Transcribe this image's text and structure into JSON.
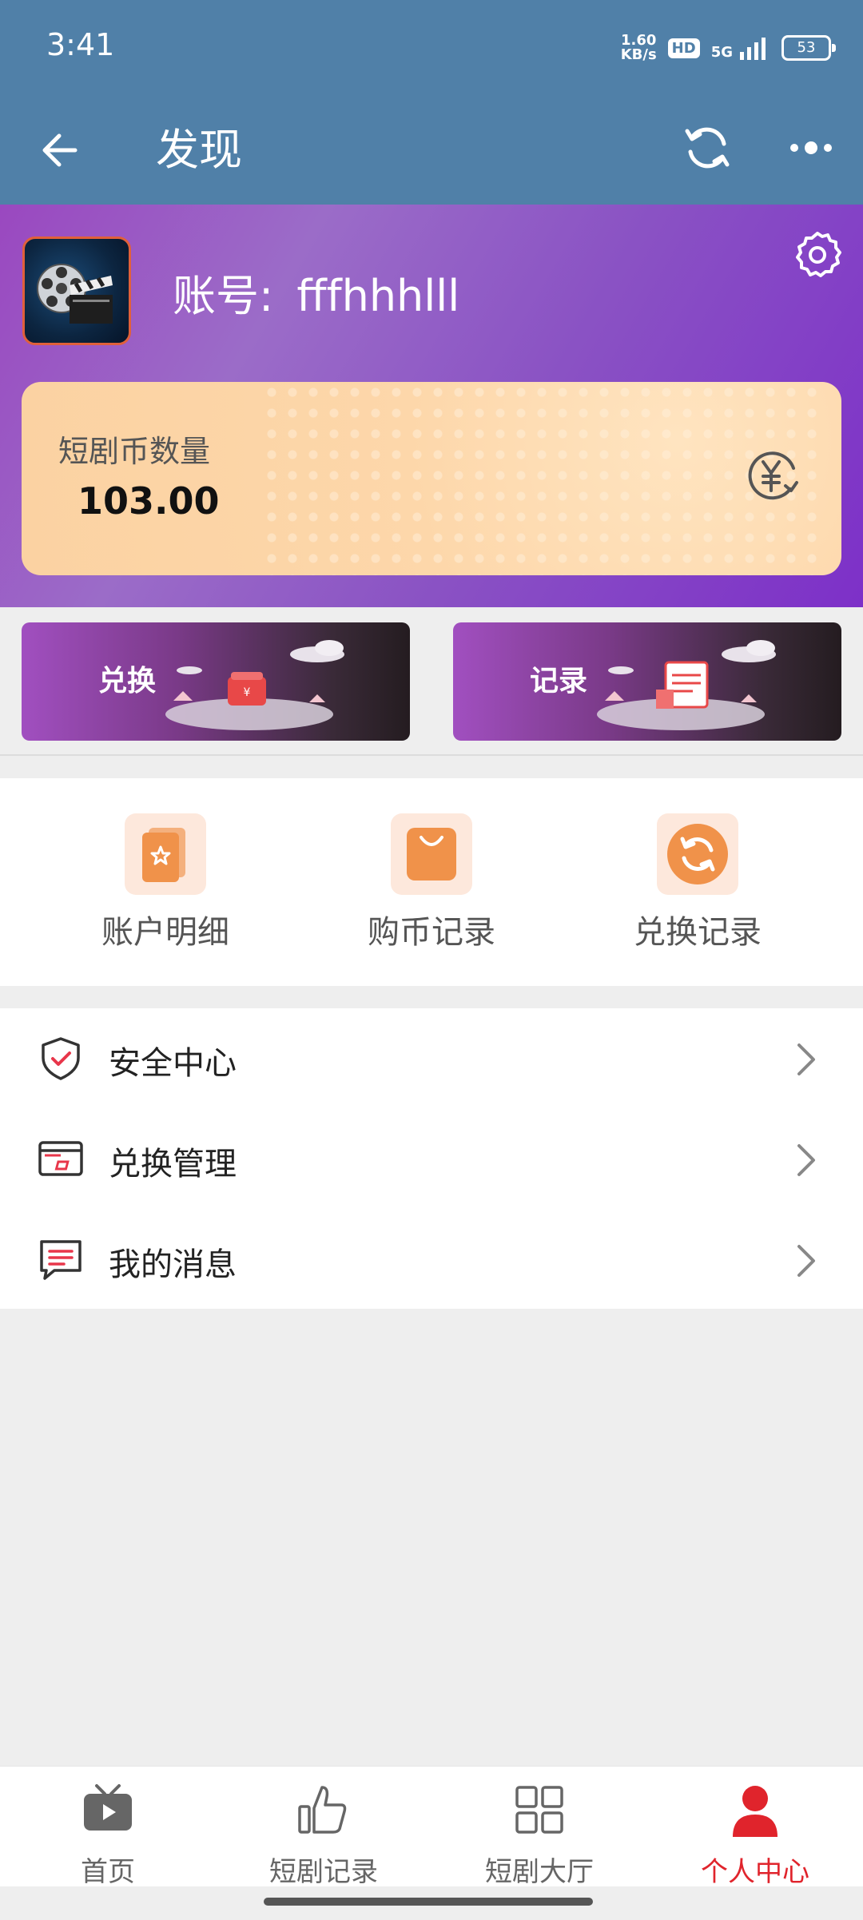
{
  "status_bar": {
    "time": "3:41",
    "net_speed_value": "1.60",
    "net_speed_unit": "KB/s",
    "hd_badge": "HD",
    "network": "5G",
    "battery": "53"
  },
  "app_bar": {
    "title": "发现"
  },
  "profile": {
    "account_label": "账号:",
    "account_value": "fffhhhlll",
    "coin_label": "短剧币数量",
    "coin_value": "103.00"
  },
  "banners": {
    "exchange_label": "兑换",
    "record_label": "记录"
  },
  "shortcuts": [
    {
      "label": "账户明细",
      "icon": "document-star-icon"
    },
    {
      "label": "购币记录",
      "icon": "shopping-bag-icon"
    },
    {
      "label": "兑换记录",
      "icon": "exchange-cycle-icon"
    }
  ],
  "menu": [
    {
      "label": "安全中心",
      "icon": "shield-check-icon"
    },
    {
      "label": "兑换管理",
      "icon": "card-icon"
    },
    {
      "label": "我的消息",
      "icon": "message-icon"
    }
  ],
  "tabbar": [
    {
      "label": "首页",
      "icon": "tv-play-icon"
    },
    {
      "label": "短剧记录",
      "icon": "thumbs-up-icon"
    },
    {
      "label": "短剧大厅",
      "icon": "grid-icon"
    },
    {
      "label": "个人中心",
      "icon": "person-icon",
      "active": true
    }
  ],
  "colors": {
    "header": "#5080a8",
    "active_tab": "#e0242c",
    "shortcut_icon": "#f0924a",
    "menu_icon_accent": "#e8364a"
  }
}
